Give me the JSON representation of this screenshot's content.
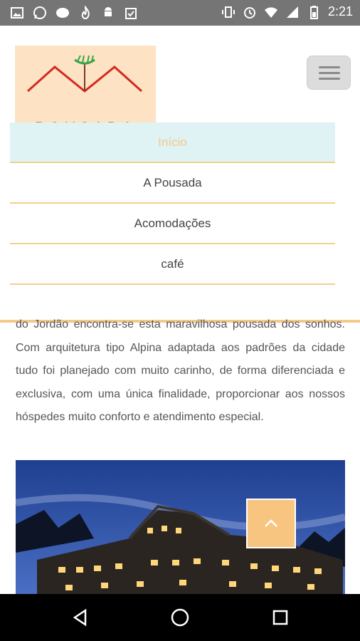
{
  "status_bar": {
    "time": "2:21",
    "left_icons": [
      "image-icon",
      "whatsapp-icon",
      "chat-bubble-icon",
      "flame-icon",
      "android-icon",
      "clipboard-icon"
    ],
    "right_icons": [
      "vibrate-icon",
      "alarm-icon",
      "wifi-icon",
      "signal-icon",
      "battery-icon"
    ]
  },
  "logo": {
    "text": "POUSADA"
  },
  "menu": {
    "items": [
      {
        "label": "Início",
        "active": true
      },
      {
        "label": "A Pousada",
        "active": false
      },
      {
        "label": "Acomodações",
        "active": false
      },
      {
        "label": "café",
        "active": false
      }
    ]
  },
  "content": {
    "paragraph": "do Jordão encontra-se esta maravilhosa pousada dos sonhos. Com arquitetura tipo Alpina adaptada aos padrões da cidade tudo foi planejado com muito carinho, de forma diferenciada e exclusiva, com uma única finalidade, proporcionar aos nossos hóspedes muito conforto e atendimento especial."
  },
  "colors": {
    "accent": "#f5c98a",
    "active_bg": "#dff2f4",
    "logo_bg": "#fde3c4",
    "logo_text": "#6d2a22"
  }
}
